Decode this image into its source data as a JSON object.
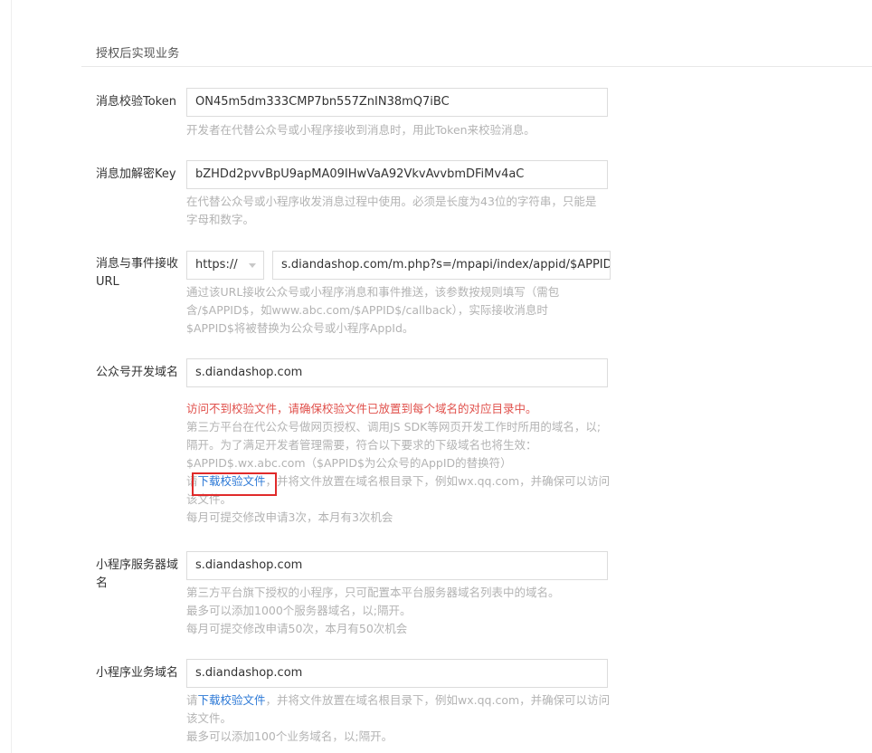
{
  "section": {
    "title": "授权后实现业务"
  },
  "fields": {
    "token": {
      "label": "消息校验Token",
      "value": "ON45m5dm333CMP7bn557ZnIN38mQ7iBC",
      "help": "开发者在代替公众号或小程序接收到消息时，用此Token来校验消息。"
    },
    "aeskey": {
      "label": "消息加解密Key",
      "value": "bZHDd2pvvBpU9apMA09IHwVaA92VkvAvvbmDFiMv4aC",
      "help_lines": [
        "在代替公众号或小程序收发消息过程中使用。必须是长度为43位的字符串，只能是",
        "字母和数字。"
      ]
    },
    "url": {
      "label": "消息与事件接收URL",
      "protocol": "https://",
      "value": "s.diandashop.com/m.php?s=/mpapi/index/appid/$APPID$",
      "help_lines": [
        "通过该URL接收公众号或小程序消息和事件推送，该参数按规则填写（需包",
        "含/$APPID$，如www.abc.com/$APPID$/callback），实际接收消息时",
        "$APPID$将被替换为公众号或小程序AppId。"
      ]
    },
    "mp_domain": {
      "label": "公众号开发域名",
      "value": "s.diandashop.com",
      "error": "访问不到校验文件，请确保校验文件已放置到每个域名的对应目录中。",
      "help_lines": [
        "第三方平台在代公众号做网页授权、调用JS SDK等网页开发工作时所用的域名，以;",
        "隔开。为了满足开发者管理需要，符合以下要求的下级域名也将生效：",
        "$APPID$.wx.abc.com（$APPID$为公众号的AppID的替换符）"
      ],
      "download_prefix": "请",
      "download_link": "下载校验文件",
      "download_suffix": "，并将文件放置在域名根目录下，例如wx.qq.com，并确保可以访问",
      "download_suffix2": "该文件。",
      "quota": "每月可提交修改申请3次，本月有3次机会"
    },
    "miniapp_server": {
      "label": "小程序服务器域名",
      "value": "s.diandashop.com",
      "help_lines": [
        "第三方平台旗下授权的小程序，只可配置本平台服务器域名列表中的域名。",
        "最多可以添加1000个服务器域名，以;隔开。",
        "每月可提交修改申请50次，本月有50次机会"
      ]
    },
    "miniapp_business": {
      "label": "小程序业务域名",
      "value": "s.diandashop.com",
      "download_prefix": "请",
      "download_link": "下载校验文件",
      "download_suffix": "，并将文件放置在域名根目录下，例如wx.qq.com，并确保可以访问",
      "download_suffix2": "该文件。",
      "quota": "最多可以添加100个业务域名，以;隔开。"
    }
  },
  "colors": {
    "error": "#e0504b",
    "link": "#2b78d6",
    "highlight": "#e02a2a"
  }
}
